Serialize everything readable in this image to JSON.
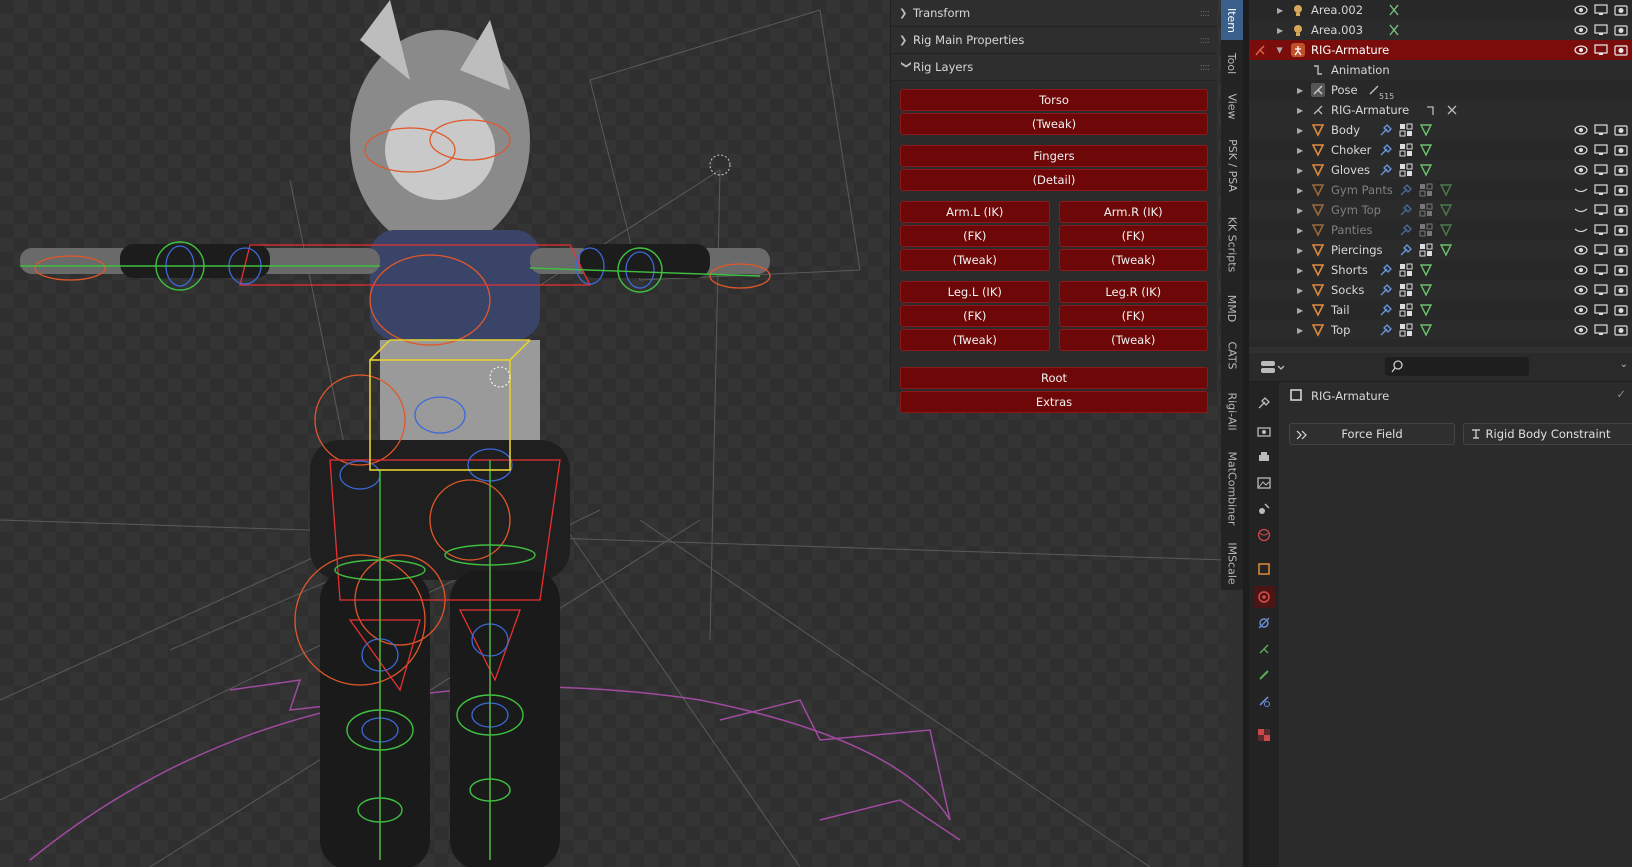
{
  "npanel": {
    "sections": [
      {
        "label": "Transform",
        "expanded": false
      },
      {
        "label": "Rig Main Properties",
        "expanded": false
      },
      {
        "label": "Rig Layers",
        "expanded": true
      }
    ],
    "rig_layers": {
      "torso": "Torso",
      "torso_tweak": "(Tweak)",
      "fingers": "Fingers",
      "fingers_detail": "(Detail)",
      "arm_l_ik": "Arm.L (IK)",
      "arm_r_ik": "Arm.R (IK)",
      "arm_l_fk": "(FK)",
      "arm_r_fk": "(FK)",
      "arm_l_tweak": "(Tweak)",
      "arm_r_tweak": "(Tweak)",
      "leg_l_ik": "Leg.L (IK)",
      "leg_r_ik": "Leg.R (IK)",
      "leg_l_fk": "(FK)",
      "leg_r_fk": "(FK)",
      "leg_l_tweak": "(Tweak)",
      "leg_r_tweak": "(Tweak)",
      "root": "Root",
      "extras": "Extras"
    }
  },
  "side_tabs": [
    "Item",
    "Tool",
    "View",
    "PSK / PSA",
    "KK Scripts",
    "MMD",
    "CATS",
    "Rigi-All",
    "MatCombiner",
    "IMScale"
  ],
  "active_side_tab": "Item",
  "outliner": {
    "rows": [
      {
        "label": "Area.002",
        "type": "light",
        "dim": false
      },
      {
        "label": "Area.003",
        "type": "light",
        "dim": false
      },
      {
        "label": "RIG-Armature",
        "type": "armature",
        "selected": true
      },
      {
        "label": "Animation",
        "type": "anim"
      },
      {
        "label": "Pose",
        "type": "pose",
        "badge": "515"
      },
      {
        "label": "RIG-Armature",
        "type": "armature-data"
      },
      {
        "label": "Body",
        "type": "mesh"
      },
      {
        "label": "Choker",
        "type": "mesh"
      },
      {
        "label": "Gloves",
        "type": "mesh"
      },
      {
        "label": "Gym Pants",
        "type": "mesh",
        "dim": true
      },
      {
        "label": "Gym Top",
        "type": "mesh",
        "dim": true
      },
      {
        "label": "Panties",
        "type": "mesh",
        "dim": true
      },
      {
        "label": "Piercings",
        "type": "mesh"
      },
      {
        "label": "Shorts",
        "type": "mesh"
      },
      {
        "label": "Socks",
        "type": "mesh"
      },
      {
        "label": "Tail",
        "type": "mesh"
      },
      {
        "label": "Top",
        "type": "mesh"
      }
    ]
  },
  "properties": {
    "search_placeholder": "",
    "object_name": "RIG-Armature",
    "force_field_label": "Force Field",
    "rigid_body_constraint_label": "Rigid Body Constraint",
    "active_tab": "physics-tab"
  },
  "colors": {
    "rig_button": "#6e0707",
    "selection": "#7a0c0c",
    "active_tab": "#3a5f8a"
  }
}
